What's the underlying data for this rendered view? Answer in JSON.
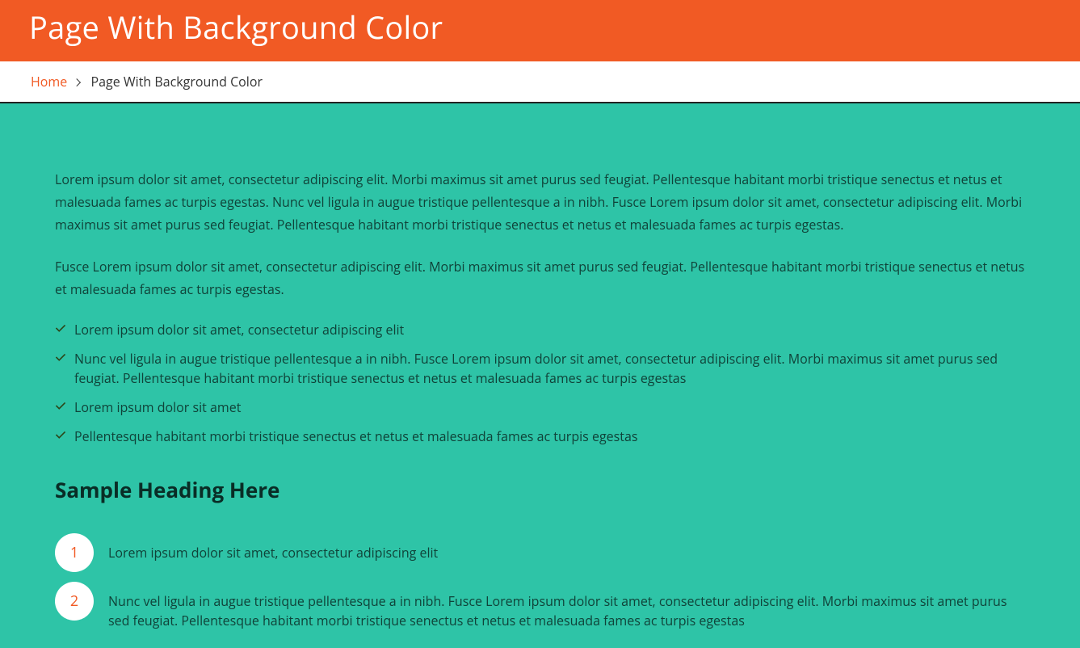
{
  "header": {
    "title": "Page With Background Color"
  },
  "breadcrumb": {
    "home": "Home",
    "current": "Page With Background Color"
  },
  "content": {
    "para1": "Lorem ipsum dolor sit amet, consectetur adipiscing elit. Morbi maximus sit amet purus sed feugiat. Pellentesque habitant morbi tristique senectus et netus et malesuada fames ac turpis egestas. Nunc vel ligula in augue tristique pellentesque a in nibh. Fusce Lorem ipsum dolor sit amet, consectetur adipiscing elit. Morbi maximus sit amet purus sed feugiat. Pellentesque habitant morbi tristique senectus et netus et malesuada fames ac turpis egestas.",
    "para2": "Fusce Lorem ipsum dolor sit amet, consectetur adipiscing elit. Morbi maximus sit amet purus sed feugiat. Pellentesque habitant morbi tristique senectus et netus et malesuada fames ac turpis egestas.",
    "checklist": [
      "Lorem ipsum dolor sit amet, consectetur adipiscing elit",
      "Nunc vel ligula in augue tristique pellentesque a in nibh. Fusce Lorem ipsum dolor sit amet, consectetur adipiscing elit. Morbi maximus sit amet purus sed feugiat. Pellentesque habitant morbi tristique senectus et netus et malesuada fames ac turpis egestas",
      "Lorem ipsum dolor sit amet",
      "Pellentesque habitant morbi tristique senectus et netus et malesuada fames ac turpis egestas"
    ],
    "sample_heading": "Sample Heading Here",
    "numlist": [
      {
        "n": "1",
        "text": "Lorem ipsum dolor sit amet, consectetur adipiscing elit"
      },
      {
        "n": "2",
        "text": "Nunc vel ligula in augue tristique pellentesque a in nibh. Fusce Lorem ipsum dolor sit amet, consectetur adipiscing elit. Morbi maximus sit amet purus sed feugiat. Pellentesque habitant morbi tristique senectus et netus et malesuada fames ac turpis egestas"
      }
    ]
  },
  "colors": {
    "accent": "#f15a24",
    "content_bg": "#2ec4a7"
  }
}
